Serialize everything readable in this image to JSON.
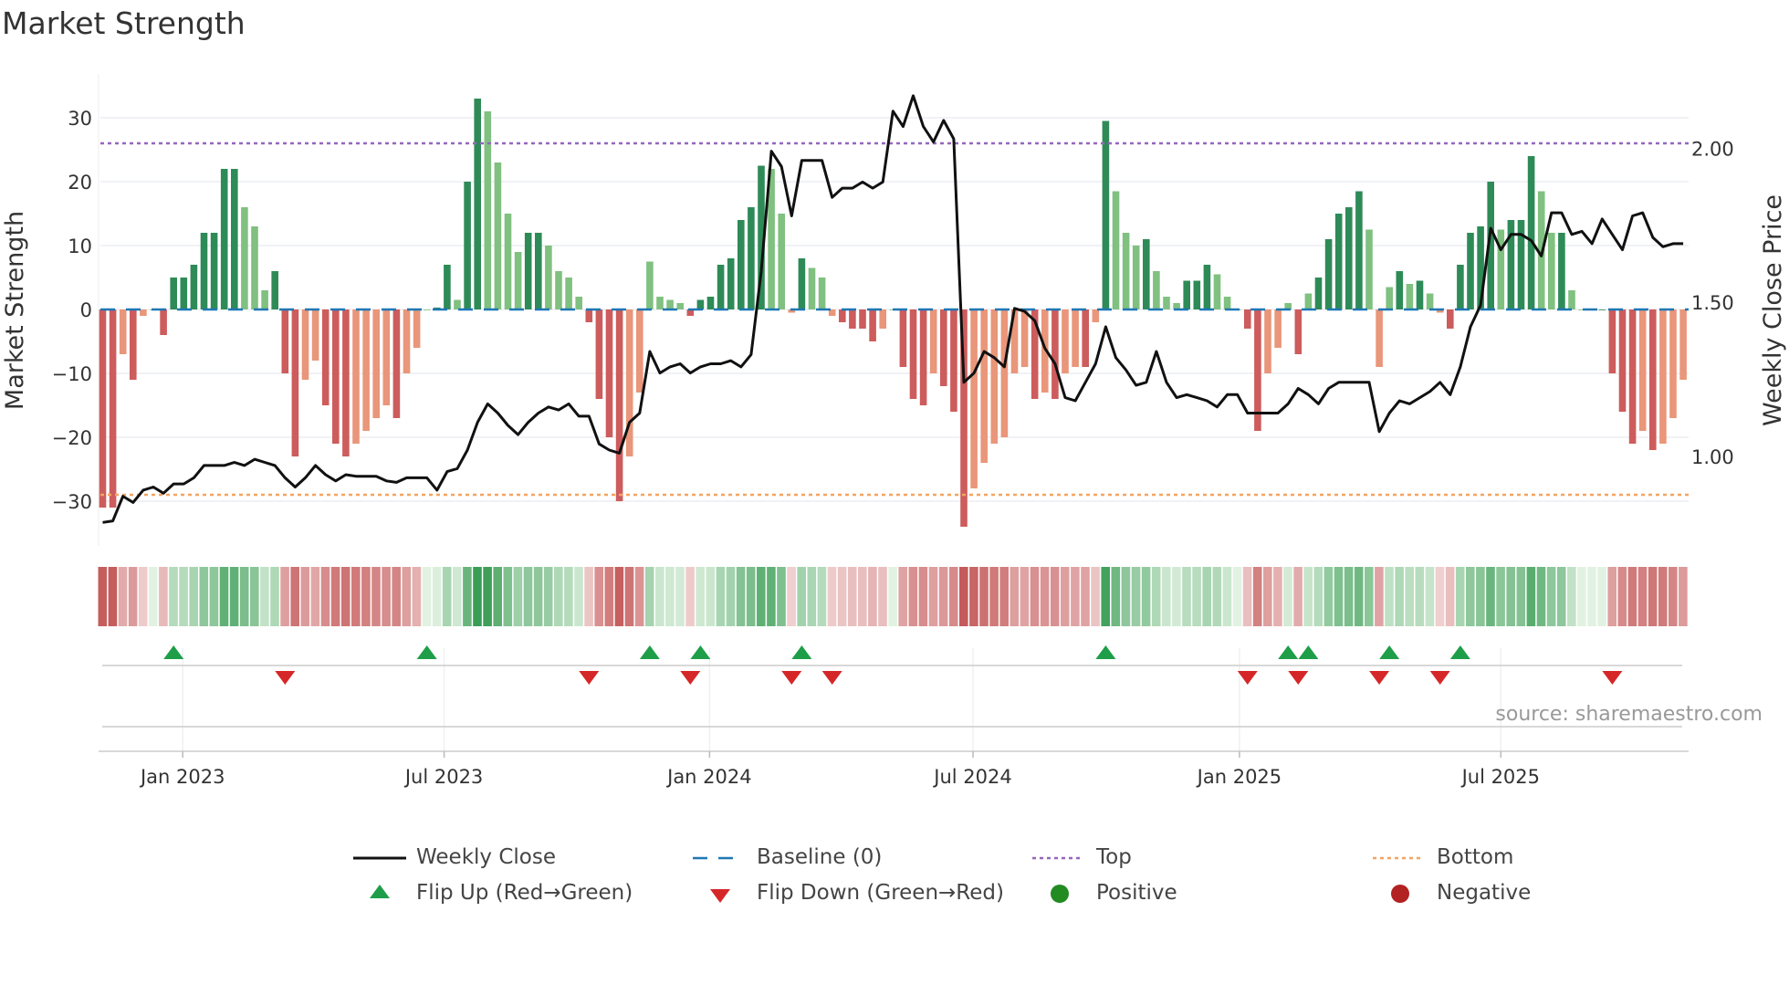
{
  "chart_data": {
    "type": "bar",
    "title": "Market Strength",
    "ylabel": "Market Strength",
    "y2label": "Weekly Close Price",
    "ylim": [
      -37,
      38
    ],
    "y_ticks": [
      30,
      20,
      10,
      0,
      -10,
      -20,
      -30
    ],
    "y_tick_labels": [
      "30",
      "20",
      "10",
      "0",
      "−10",
      "−20",
      "−30"
    ],
    "y2_ticks": [
      2.0,
      1.5,
      1.0
    ],
    "y2_tick_labels": [
      "2.00",
      "1.50",
      "1.00"
    ],
    "frequency": "weekly",
    "x_ticks": [
      {
        "label": "Jan 2023",
        "week": 7.9
      },
      {
        "label": "Jul 2023",
        "week": 33.7
      },
      {
        "label": "Jan 2024",
        "week": 59.9
      },
      {
        "label": "Jul 2024",
        "week": 85.9
      },
      {
        "label": "Jan 2025",
        "week": 112.2
      },
      {
        "label": "Jul 2025",
        "week": 138.0
      }
    ],
    "top_threshold": 26,
    "bottom_threshold": -29,
    "strength": [
      -31,
      -31,
      -7,
      -11,
      -1,
      0,
      -4,
      5,
      5,
      7,
      12,
      12,
      22,
      22,
      16,
      13,
      3,
      6,
      -10,
      -23,
      -11,
      -8,
      -15,
      -21,
      -23,
      -21,
      -19,
      -17,
      -15,
      -17,
      -10,
      -6,
      0,
      0.3,
      7,
      1.5,
      20,
      33,
      31,
      23,
      15,
      9,
      12,
      12,
      10,
      6,
      5,
      2,
      -2,
      -14,
      -20,
      -30,
      -23,
      -13,
      7.5,
      2,
      1.5,
      1,
      -1,
      1.5,
      2,
      7,
      8,
      14,
      16,
      22.5,
      22,
      15,
      -0.5,
      8,
      6.5,
      5,
      -1,
      -2,
      -3,
      -3,
      -5,
      -3,
      0,
      -9,
      -14,
      -15,
      -10,
      -12,
      -16,
      -34,
      -28,
      -24,
      -21,
      -20,
      -10,
      -9,
      -14,
      -13,
      -14,
      -10,
      -9,
      -9,
      -2,
      29.5,
      18.5,
      12,
      10,
      11,
      6,
      2,
      1,
      4.5,
      4.5,
      7,
      5.5,
      2,
      0,
      -3,
      -19,
      -10,
      -6,
      1,
      -7,
      2.5,
      5,
      11,
      15,
      16,
      18.5,
      12.5,
      -9,
      3.5,
      6,
      4,
      4.5,
      2.5,
      -0.5,
      -3,
      7,
      12,
      13,
      20,
      12.5,
      14,
      14,
      24,
      18.5,
      12,
      12,
      3,
      0,
      0,
      0,
      -10,
      -16,
      -21,
      -19,
      -22,
      -21,
      -17,
      -11
    ],
    "weekly_close": [
      0.785,
      0.79,
      0.87,
      0.85,
      0.89,
      0.9,
      0.88,
      0.91,
      0.91,
      0.93,
      0.97,
      0.97,
      0.97,
      0.98,
      0.97,
      0.99,
      0.98,
      0.97,
      0.93,
      0.9,
      0.93,
      0.97,
      0.94,
      0.92,
      0.94,
      0.935,
      0.935,
      0.935,
      0.92,
      0.915,
      0.93,
      0.93,
      0.93,
      0.89,
      0.95,
      0.96,
      1.02,
      1.11,
      1.17,
      1.14,
      1.1,
      1.07,
      1.11,
      1.14,
      1.16,
      1.15,
      1.17,
      1.13,
      1.13,
      1.04,
      1.02,
      1.01,
      1.11,
      1.14,
      1.34,
      1.27,
      1.29,
      1.3,
      1.27,
      1.29,
      1.3,
      1.3,
      1.31,
      1.29,
      1.33,
      1.6,
      1.99,
      1.94,
      1.78,
      1.96,
      1.96,
      1.96,
      1.84,
      1.87,
      1.87,
      1.89,
      1.87,
      1.89,
      2.12,
      2.07,
      2.17,
      2.07,
      2.02,
      2.09,
      2.03,
      1.24,
      1.27,
      1.34,
      1.32,
      1.29,
      1.48,
      1.47,
      1.44,
      1.35,
      1.3,
      1.19,
      1.18,
      1.24,
      1.3,
      1.42,
      1.32,
      1.28,
      1.23,
      1.24,
      1.34,
      1.24,
      1.19,
      1.2,
      1.19,
      1.18,
      1.16,
      1.2,
      1.2,
      1.14,
      1.14,
      1.14,
      1.14,
      1.17,
      1.22,
      1.2,
      1.17,
      1.22,
      1.24,
      1.24,
      1.24,
      1.24,
      1.08,
      1.14,
      1.18,
      1.17,
      1.19,
      1.21,
      1.24,
      1.2,
      1.29,
      1.42,
      1.49,
      1.74,
      1.67,
      1.72,
      1.72,
      1.7,
      1.65,
      1.79,
      1.79,
      1.72,
      1.73,
      1.69,
      1.77,
      1.72,
      1.67,
      1.78,
      1.79,
      1.71,
      1.68,
      1.69,
      1.69
    ],
    "flip_up_weeks": [
      7,
      32,
      54,
      59,
      69,
      99,
      117,
      119,
      127,
      134
    ],
    "flip_down_weeks": [
      18,
      48,
      58,
      68,
      72,
      113,
      118,
      126,
      132,
      149
    ],
    "legend": {
      "placement": "bottom",
      "items": [
        {
          "label": "Weekly Close",
          "symbol": "line"
        },
        {
          "label": "Baseline (0)",
          "symbol": "dash"
        },
        {
          "label": "Top",
          "symbol": "dotted-purple"
        },
        {
          "label": "Bottom",
          "symbol": "dotted-orange"
        },
        {
          "label": "Flip Up (Red→Green)",
          "symbol": "triangle-up"
        },
        {
          "label": "Flip Down (Green→Red)",
          "symbol": "triangle-down"
        },
        {
          "label": "Positive",
          "symbol": "circle-green"
        },
        {
          "label": "Negative",
          "symbol": "circle-red"
        }
      ]
    },
    "colors": {
      "pos_strong": "#2e8b57",
      "pos_weak": "#80c080",
      "neg_strong": "#cd5c5c",
      "neg_weak": "#e9967a",
      "baseline": "#1f77b4",
      "top": "#9467bd",
      "bottom": "#f4a460",
      "flip_up": "#1e9e48",
      "flip_down": "#d62728",
      "positive": "#228b22",
      "negative": "#b22222",
      "price": "#111111"
    },
    "source": "source: sharemaestro.com"
  }
}
